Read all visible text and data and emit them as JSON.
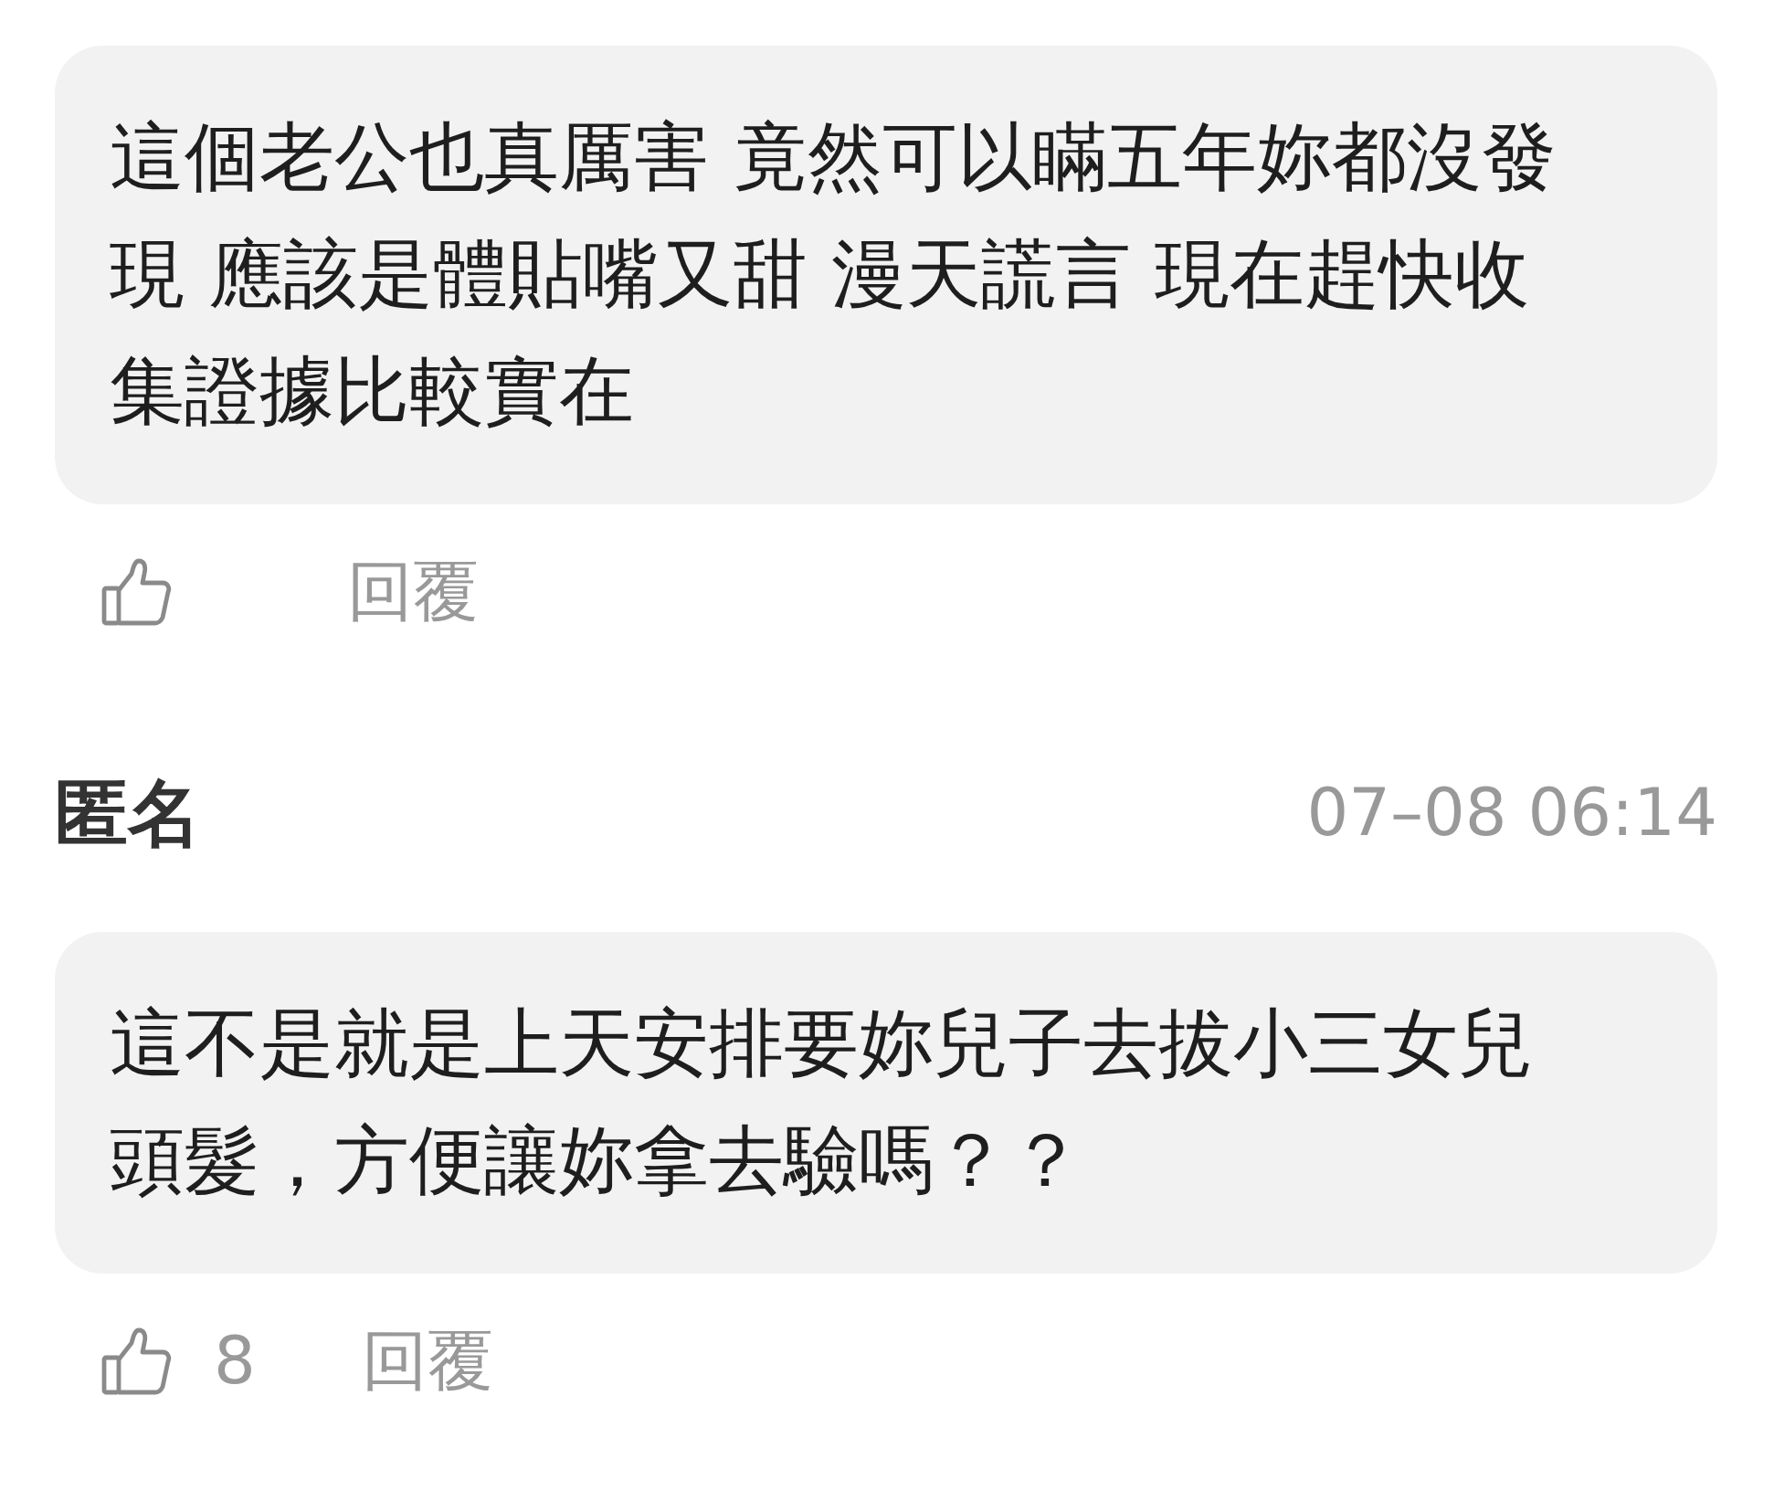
{
  "comments": [
    {
      "text": "這個老公也真厲害 竟然可以瞞五年妳都沒發現 應該是體貼嘴又甜 漫天謊言 現在趕快收集證據比較實在",
      "reply_label": "回覆"
    },
    {
      "author": "匿名",
      "time": "07–08 06:14",
      "text": "這不是就是上天安排要妳兒子去拔小三女兒頭髮，方便讓妳拿去驗嗎？？",
      "likes": "8",
      "reply_label": "回覆"
    }
  ]
}
